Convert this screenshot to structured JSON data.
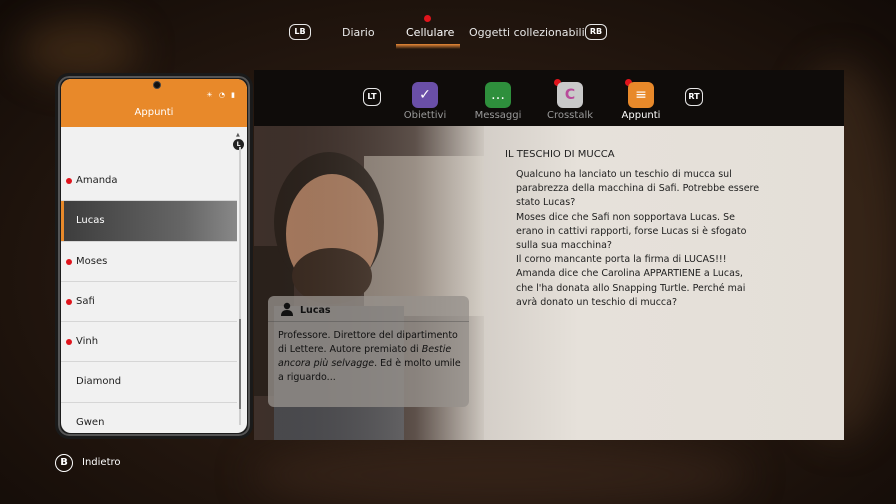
{
  "top_nav": {
    "lb_button": "LB",
    "rb_button": "RB",
    "tabs": [
      {
        "label": "Diario",
        "active": false
      },
      {
        "label": "Cellulare",
        "active": true,
        "notification": true
      },
      {
        "label": "Oggetti collezionabili",
        "active": false
      }
    ]
  },
  "phone": {
    "title": "Appunti",
    "scroll_hint_button": "L",
    "contacts": [
      {
        "name": "Amanda",
        "unread": true,
        "selected": false
      },
      {
        "name": "Lucas",
        "unread": false,
        "selected": true
      },
      {
        "name": "Moses",
        "unread": true,
        "selected": false
      },
      {
        "name": "Safi",
        "unread": true,
        "selected": false
      },
      {
        "name": "Vinh",
        "unread": true,
        "selected": false
      },
      {
        "name": "Diamond",
        "unread": false,
        "selected": false
      },
      {
        "name": "Gwen",
        "unread": false,
        "selected": false
      }
    ]
  },
  "app_bar": {
    "lt_button": "LT",
    "rt_button": "RT",
    "apps": [
      {
        "label": "Obiettivi",
        "icon": "checkmark-icon",
        "color": "#6a4fa8",
        "active": false,
        "notification": false
      },
      {
        "label": "Messaggi",
        "icon": "chat-bubble-icon",
        "color": "#2e8f3c",
        "active": false,
        "notification": false
      },
      {
        "label": "Crosstalk",
        "icon": "crosstalk-icon",
        "color": "#b84a9a",
        "active": false,
        "notification": true
      },
      {
        "label": "Appunti",
        "icon": "notepad-icon",
        "color": "#e8892a",
        "active": true,
        "notification": true
      }
    ]
  },
  "note": {
    "title": "IL TESCHIO DI MUCCA",
    "lines": [
      "Qualcuno ha lanciato un teschio di mucca sul",
      "parabrezza della macchina di Safi. Potrebbe essere",
      "stato Lucas?",
      "Moses dice che Safi non sopportava Lucas. Se",
      "erano in cattivi rapporti, forse Lucas si è sfogato",
      "sulla sua macchina?",
      "Il corno mancante porta la firma di LUCAS!!!",
      "Amanda dice che Carolina APPARTIENE a Lucas,",
      "che l'ha donata allo Snapping Turtle. Perché mai",
      "avrà donato un teschio di mucca?"
    ]
  },
  "character": {
    "name": "Lucas",
    "desc_part1": "Professore. Direttore del dipartimento di Lettere. Autore premiato di ",
    "desc_italic": "Bestie ancora più selvagge",
    "desc_part2": ". Ed è molto umile a riguardo..."
  },
  "footer": {
    "back_button": "B",
    "back_label": "Indietro"
  },
  "colors": {
    "accent": "#e8892a",
    "notification": "#e0141c"
  }
}
